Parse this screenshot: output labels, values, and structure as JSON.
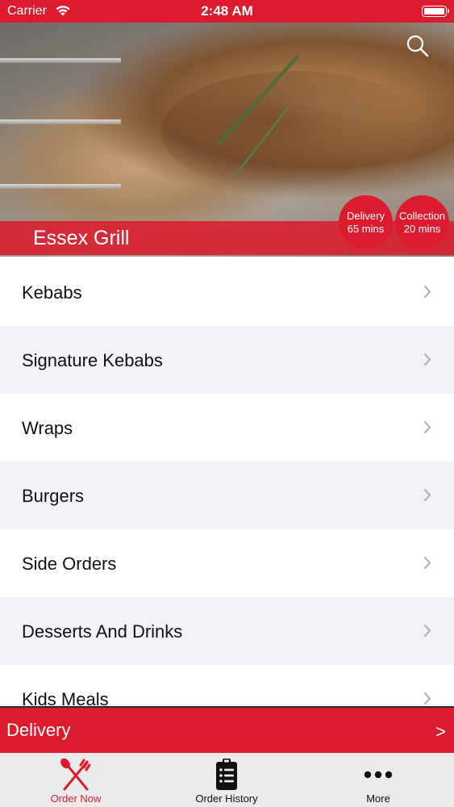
{
  "status_bar": {
    "carrier": "Carrier",
    "time": "2:48 AM"
  },
  "restaurant": {
    "name": "Essex Grill"
  },
  "badges": {
    "delivery": {
      "label": "Delivery",
      "time": "65 mins"
    },
    "collection": {
      "label": "Collection",
      "time": "20 mins"
    }
  },
  "menu": {
    "categories": [
      {
        "label": "Kebabs"
      },
      {
        "label": "Signature Kebabs"
      },
      {
        "label": "Wraps"
      },
      {
        "label": "Burgers"
      },
      {
        "label": "Side Orders"
      },
      {
        "label": "Desserts And Drinks"
      },
      {
        "label": "Kids Meals"
      }
    ]
  },
  "order_mode_bar": {
    "mode": "Delivery",
    "arrow": ">"
  },
  "tab_bar": {
    "tabs": [
      {
        "label": "Order Now",
        "icon": "fork-knife-icon",
        "active": true
      },
      {
        "label": "Order History",
        "icon": "clipboard-list-icon",
        "active": false
      },
      {
        "label": "More",
        "icon": "more-dots-icon",
        "active": false
      }
    ]
  },
  "colors": {
    "brand_red": "#dc1c2e",
    "tab_bar_bg": "#ebebeb",
    "row_alt_bg": "#f2f3f6"
  }
}
